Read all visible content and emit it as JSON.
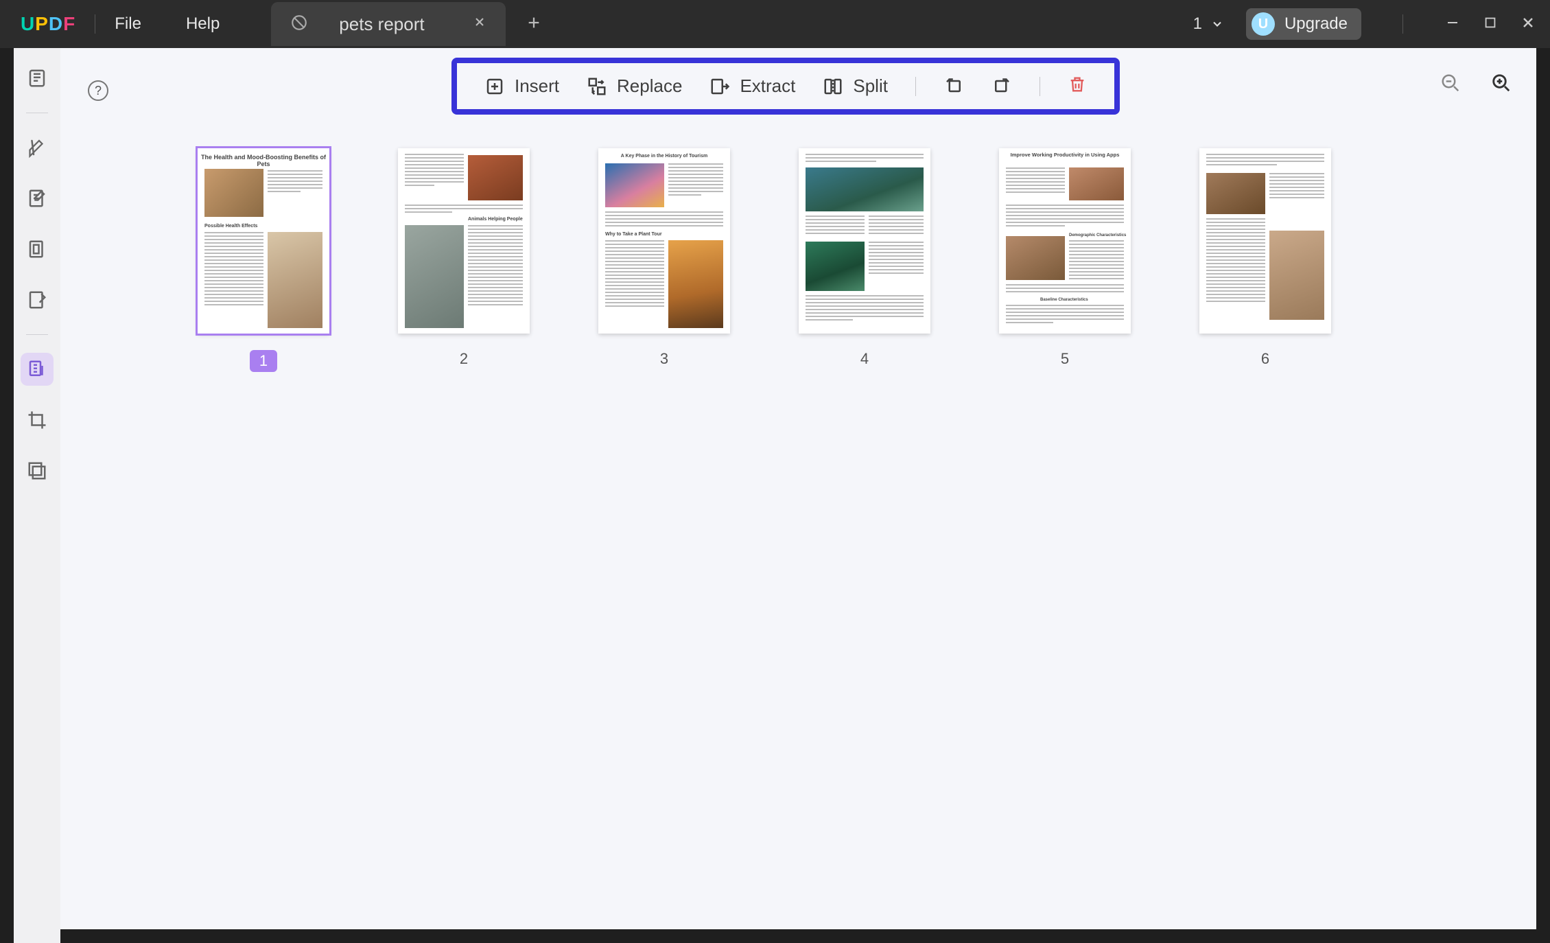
{
  "app": {
    "logo": "UPDF"
  },
  "menu": {
    "file": "File",
    "help": "Help"
  },
  "tab": {
    "label": "pets report"
  },
  "titlebar": {
    "page_number": "1",
    "upgrade": "Upgrade",
    "avatar_initial": "U"
  },
  "toolbar": {
    "insert": "Insert",
    "replace": "Replace",
    "extract": "Extract",
    "split": "Split"
  },
  "pages": {
    "p1": {
      "num": "1",
      "title": "The Health and Mood-Boosting Benefits of Pets",
      "sub1": "Possible Health Effects"
    },
    "p2": {
      "num": "2",
      "title": "Animals Helping People"
    },
    "p3": {
      "num": "3",
      "title": "A Key Phase in the History of Tourism",
      "sub1": "Why to Take a Plant Tour"
    },
    "p4": {
      "num": "4"
    },
    "p5": {
      "num": "5",
      "title": "Improve Working Productivity in Using Apps",
      "sub1": "Demographic Characteristics",
      "sub2": "Baseline Characteristics"
    },
    "p6": {
      "num": "6"
    }
  }
}
